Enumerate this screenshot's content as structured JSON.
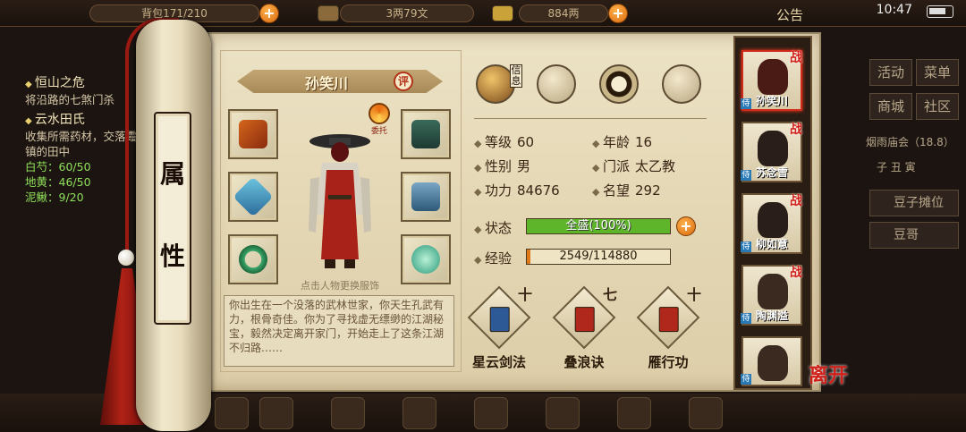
{
  "topbar": {
    "bag_text": "背包171/210",
    "copper": "3两79文",
    "silver": "884两",
    "notice": "公告",
    "clock": "10:47"
  },
  "quest_panel": {
    "quests": [
      {
        "title": "恒山之危",
        "desc": "将沿路的七煞门杀"
      },
      {
        "title": "云水田氏",
        "desc": "收集所需药材，交落霞镇的田中"
      }
    ],
    "items": [
      "白芍：60/50",
      "地黄：46/50",
      "泥鳅：9/20"
    ]
  },
  "right_menu": {
    "buttons": [
      "活动",
      "菜单",
      "商城",
      "社区"
    ],
    "note": "烟雨庙会（18.8）",
    "sub": "子 丑 寅",
    "bars": [
      "豆子摊位",
      "豆哥"
    ]
  },
  "scroll": {
    "rod_label": [
      "属",
      "性"
    ]
  },
  "character": {
    "name": "孙笑川",
    "eval_badge": "评",
    "entrust": "委托",
    "change_hint": "点击人物更换服饰",
    "bio": "你出生在一个没落的武林世家，你天生孔武有力，根骨奇佳。你为了寻找虚无缥缈的江湖秘宝，毅然决定离开家门，开始走上了这条江湖不归路……"
  },
  "tabs": [
    {
      "label": "信息",
      "icon": "info-bamboo-hat-icon"
    },
    {
      "label": "",
      "icon": "map-scroll-icon"
    },
    {
      "label": "",
      "icon": "yin-yang-icon"
    },
    {
      "label": "",
      "icon": "meridian-body-icon"
    }
  ],
  "stats": {
    "level_label": "等级",
    "level": "60",
    "age_label": "年龄",
    "age": "16",
    "gender_label": "性别",
    "gender": "男",
    "sect_label": "门派",
    "sect": "太乙教",
    "power_label": "功力",
    "power": "84676",
    "fame_label": "名望",
    "fame": "292",
    "status_label": "状态",
    "status_text": "全盛(100%)",
    "status_fraction": 1.0,
    "exp_label": "经验",
    "exp_text": "2549/114880",
    "exp_fraction": 0.022
  },
  "skills": [
    {
      "name": "星云剑法",
      "level": "十",
      "book_color": "#2d5a96"
    },
    {
      "name": "叠浪诀",
      "level": "七",
      "book_color": "#b0281c"
    },
    {
      "name": "雁行功",
      "level": "十",
      "book_color": "#b0281c"
    }
  ],
  "party": [
    {
      "name": "孙笑川",
      "battle": "战",
      "active": true
    },
    {
      "name": "苏念雪",
      "battle": "战",
      "active": false
    },
    {
      "name": "柳如意",
      "battle": "战",
      "active": false
    },
    {
      "name": "陶渊溢",
      "battle": "战",
      "active": false
    },
    {
      "name": "",
      "battle": "",
      "active": false
    }
  ],
  "leave_label": "离开",
  "colors": {
    "status_fill": "#5fb52a",
    "exp_fill": "#e07a18",
    "accent_red": "#d0201a"
  }
}
